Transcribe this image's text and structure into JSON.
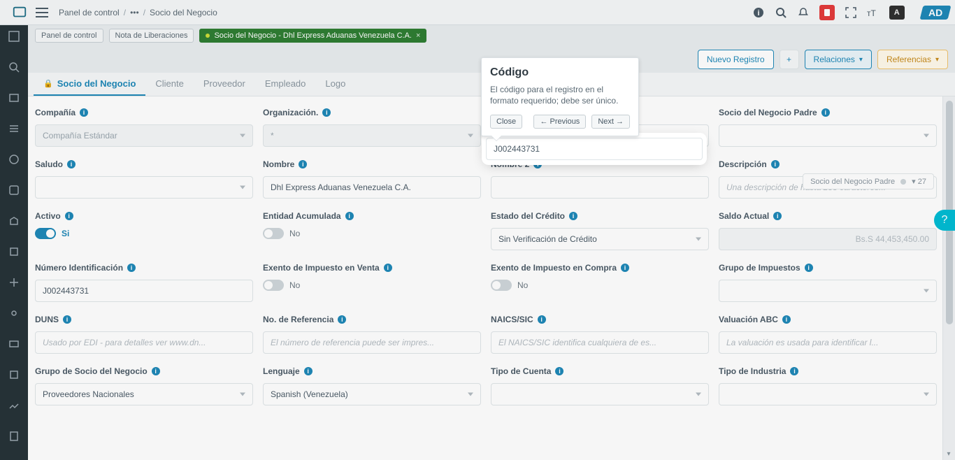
{
  "breadcrumb": {
    "root": "Panel de control",
    "dots": "•••",
    "current": "Socio del Negocio"
  },
  "tabs": {
    "t1": "Panel de control",
    "t2": "Nota de Liberaciones",
    "t3": "Socio del Negocio - Dhl Express Aduanas Venezuela C.A."
  },
  "toolbar": {
    "new": "Nuevo Registro",
    "plus": "+",
    "rel": "Relaciones",
    "ref": "Referencias"
  },
  "innerTabs": {
    "t1": "Socio del Negocio",
    "t2": "Cliente",
    "t3": "Proveedor",
    "t4": "Empleado",
    "t5": "Logo"
  },
  "summary": {
    "label": "Socio del Negocio Padre",
    "count": "▾ 27"
  },
  "popover": {
    "title": "Código",
    "body": "El código para el registro en el formato requerido; debe ser único.",
    "close": "Close",
    "prev": "← Previous",
    "next": "Next →"
  },
  "labels": {
    "compania": "Compañía",
    "organizacion": "Organización.",
    "codigo": "Código",
    "socioPadre": "Socio del Negocio Padre",
    "saludo": "Saludo",
    "nombre": "Nombre",
    "nombre2": "Nombre 2",
    "descripcion": "Descripción",
    "activo": "Activo",
    "entidadAcumulada": "Entidad Acumulada",
    "estadoCredito": "Estado del Crédito",
    "saldoActual": "Saldo Actual",
    "numeroId": "Número Identificación",
    "exentoVenta": "Exento de Impuesto en Venta",
    "exentoCompra": "Exento de Impuesto en Compra",
    "grupoImpuestos": "Grupo de Impuestos",
    "duns": "DUNS",
    "noRef": "No. de Referencia",
    "naics": "NAICS/SIC",
    "valuacion": "Valuación ABC",
    "grupoSocio": "Grupo de Socio del Negocio",
    "lenguaje": "Lenguaje",
    "tipoCuenta": "Tipo de Cuenta",
    "tipoIndustria": "Tipo de Industria"
  },
  "placeholders": {
    "descripcion": "Una descripción de hasta 255 caracteres...",
    "duns": "Usado por EDI - para detalles ver www.dn...",
    "noRef": "El número de referencia puede ser impres...",
    "naics": "El NAICS/SIC identifica cualquiera de es...",
    "valuacion": "La valuación es usada para identificar l..."
  },
  "values": {
    "compania": "Compañía Estándar",
    "organizacion": "*",
    "codigo": "J002443731",
    "socioPadre": "",
    "saludo": "",
    "nombre": "Dhl Express Aduanas Venezuela C.A.",
    "nombre2": "",
    "descripcion": "",
    "activo": "Si",
    "entidadAcumulada": "No",
    "estadoCredito": "Sin Verificación de Crédito",
    "saldoActual": "Bs.S 44,453,450.00",
    "numeroId": "J002443731",
    "exentoVenta": "No",
    "exentoCompra": "No",
    "grupoImpuestos": "",
    "duns": "",
    "noRef": "",
    "naics": "",
    "valuacion": "",
    "grupoSocio": "Proveedores Nacionales",
    "lenguaje": "Spanish (Venezuela)",
    "tipoCuenta": "",
    "tipoIndustria": ""
  },
  "lang": "A",
  "adlogo": "AD"
}
